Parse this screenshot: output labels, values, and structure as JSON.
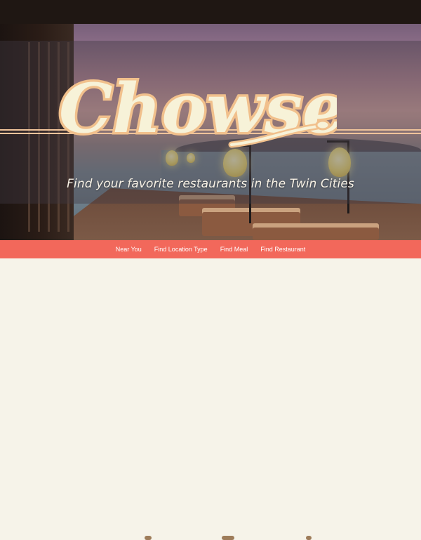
{
  "brand": {
    "name": "Chowser",
    "tagline": "Find your favorite restaurants in the Twin Cities"
  },
  "nav": {
    "items": [
      {
        "label": "Near You"
      },
      {
        "label": "Find Location Type"
      },
      {
        "label": "Find Meal"
      },
      {
        "label": "Find Restaurant"
      }
    ]
  },
  "colors": {
    "nav_background": "#f2685b",
    "logo_fill": "#f7f2d8",
    "logo_outline": "#f1c08c",
    "page_background": "#f6f3e9"
  },
  "hero": {
    "background": "restaurant terrace overlooking the sea at dusk"
  }
}
